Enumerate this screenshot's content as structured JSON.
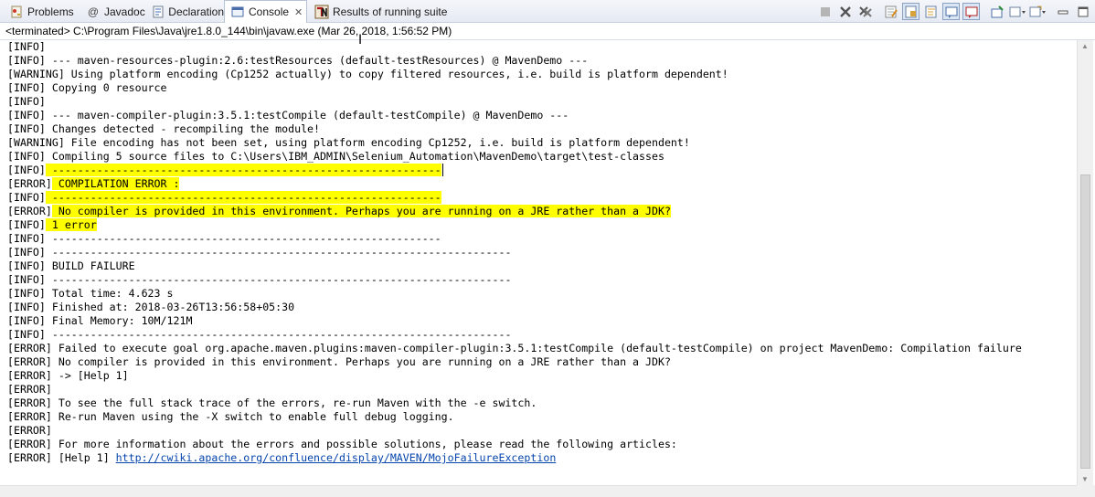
{
  "tabs": [
    {
      "label": "Problems",
      "icon": "problems-icon"
    },
    {
      "label": "Javadoc",
      "icon": "javadoc-icon"
    },
    {
      "label": "Declaration",
      "icon": "declaration-icon"
    },
    {
      "label": "Console",
      "icon": "console-icon",
      "active": true
    },
    {
      "label": "Results of running suite",
      "icon": "testng-icon"
    }
  ],
  "terminated": "<terminated> C:\\Program Files\\Java\\jre1.8.0_144\\bin\\javaw.exe (Mar 26, 2018, 1:56:52 PM)",
  "console": {
    "lines": [
      "[INFO]",
      "[INFO] --- maven-resources-plugin:2.6:testResources (default-testResources) @ MavenDemo ---",
      "[WARNING] Using platform encoding (Cp1252 actually) to copy filtered resources, i.e. build is platform dependent!",
      "[INFO] Copying 0 resource",
      "[INFO]",
      "[INFO] --- maven-compiler-plugin:3.5.1:testCompile (default-testCompile) @ MavenDemo ---",
      "[INFO] Changes detected - recompiling the module!",
      "[WARNING] File encoding has not been set, using platform encoding Cp1252, i.e. build is platform dependent!",
      "[INFO] Compiling 5 source files to C:\\Users\\IBM_ADMIN\\Selenium_Automation\\MavenDemo\\target\\test-classes",
      "[INFO] -------------------------------------------------------------",
      "[ERROR] COMPILATION ERROR :",
      "[INFO] -------------------------------------------------------------",
      "[ERROR] No compiler is provided in this environment. Perhaps you are running on a JRE rather than a JDK?",
      "[INFO] 1 error",
      "[INFO] -------------------------------------------------------------",
      "[INFO] ------------------------------------------------------------------------",
      "[INFO] BUILD FAILURE",
      "[INFO] ------------------------------------------------------------------------",
      "[INFO] Total time: 4.623 s",
      "[INFO] Finished at: 2018-03-26T13:56:58+05:30",
      "[INFO] Final Memory: 10M/121M",
      "[INFO] ------------------------------------------------------------------------",
      "[ERROR] Failed to execute goal org.apache.maven.plugins:maven-compiler-plugin:3.5.1:testCompile (default-testCompile) on project MavenDemo: Compilation failure",
      "[ERROR] No compiler is provided in this environment. Perhaps you are running on a JRE rather than a JDK?",
      "[ERROR] -> [Help 1]",
      "[ERROR]",
      "[ERROR] To see the full stack trace of the errors, re-run Maven with the -e switch.",
      "[ERROR] Re-run Maven using the -X switch to enable full debug logging.",
      "[ERROR]",
      "[ERROR] For more information about the errors and possible solutions, please read the following articles:"
    ],
    "highlight_rows": [
      9,
      10,
      11,
      12,
      13
    ],
    "highlight_color": "#ffff00",
    "last_line_prefix": "[ERROR] [Help 1] ",
    "link": "http://cwiki.apache.org/confluence/display/MAVEN/MojoFailureException",
    "link_color": "#0645ad"
  },
  "toolbar_icons": [
    "terminate-icon",
    "remove-launch-icon",
    "remove-all-icon",
    "clear-console-icon",
    "scroll-lock-icon",
    "word-wrap-icon",
    "show-on-stdout-icon",
    "show-on-stderr-icon",
    "pin-console-icon",
    "display-console-icon",
    "open-console-icon",
    "minimize-icon",
    "maximize-icon"
  ]
}
